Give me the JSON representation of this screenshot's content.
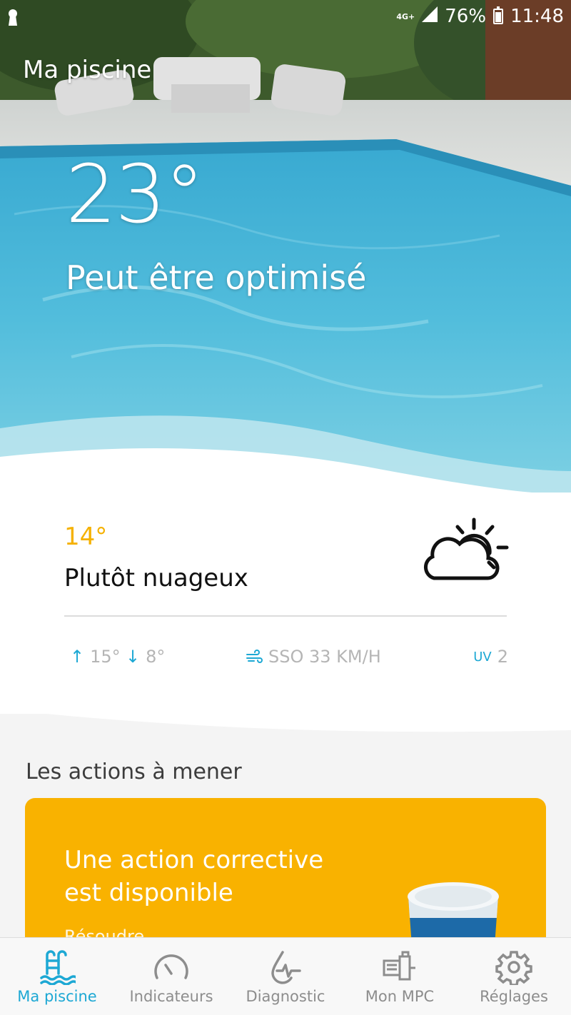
{
  "status_bar": {
    "network": "4G+",
    "battery": "76%",
    "time": "11:48"
  },
  "header": {
    "title": "Ma piscine"
  },
  "pool": {
    "temperature": "23°",
    "status": "Peut être optimisé"
  },
  "weather": {
    "temperature": "14°",
    "description": "Plutôt nuageux",
    "icon": "partly-cloudy-icon",
    "high": "15°",
    "low": "8°",
    "wind": "SSO 33 KM/H",
    "uv_label": "UV",
    "uv_value": "2"
  },
  "actions": {
    "section_title": "Les actions à mener",
    "card_title": "Une action corrective est disponible",
    "card_link": "Résoudre",
    "card_color": "#f9b200"
  },
  "bottom_nav": {
    "items": [
      {
        "label": "Ma piscine",
        "icon": "pool-ladder-icon",
        "active": true
      },
      {
        "label": "Indicateurs",
        "icon": "gauge-icon",
        "active": false
      },
      {
        "label": "Diagnostic",
        "icon": "water-drop-pulse-icon",
        "active": false
      },
      {
        "label": "Mon MPC",
        "icon": "pump-icon",
        "active": false
      },
      {
        "label": "Réglages",
        "icon": "gear-icon",
        "active": false
      }
    ]
  },
  "colors": {
    "accent": "#1da8d4",
    "warning": "#f5b100"
  }
}
